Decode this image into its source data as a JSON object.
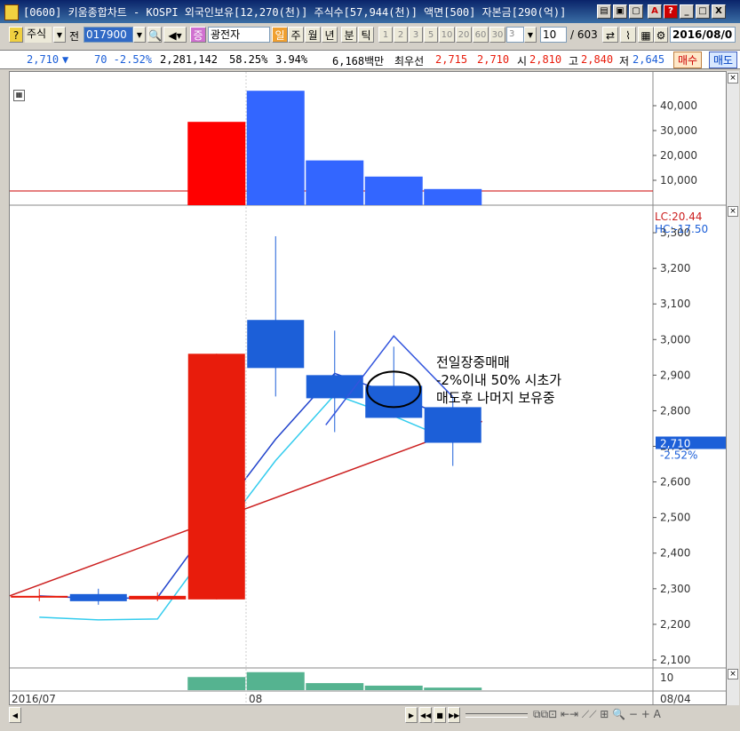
{
  "window": {
    "title": "[0600] 키움종합차트 - KOSPI 외국인보유[12,270(천)] 주식수[57,944(천)] 액면[500] 자본금[290(억)]",
    "buttons": [
      "A",
      "?",
      "_",
      "□",
      "X"
    ]
  },
  "toolbar": {
    "market_type": "주식",
    "prev_label": "전",
    "code": "017900",
    "badge": "증",
    "name": "광전자",
    "period_selected": "일",
    "periods": [
      "주",
      "월",
      "년",
      "분",
      "틱"
    ],
    "numbers": [
      "1",
      "2",
      "3",
      "5",
      "10",
      "20",
      "60",
      "30",
      "3"
    ],
    "count_value": "10",
    "count_total": "/ 603",
    "date": "2016/08/0"
  },
  "infobar": {
    "price": "2,710",
    "arrow": "▼",
    "change": "70 -2.52%",
    "volume": "2,281,142",
    "ratio1": "58.25%",
    "ratio2": "3.94%",
    "amount": "6,168백만",
    "best_label": "최우선",
    "best_ask": "2,715",
    "best_bid": "2,710",
    "open_label": "시",
    "open": "2,810",
    "high_label": "고",
    "high": "2,840",
    "low_label": "저",
    "low": "2,645",
    "sell_label": "매수",
    "buy_label": "매도"
  },
  "chart_data": {
    "type": "candlestick",
    "dates": [
      "07-d1",
      "07-d2",
      "07-d3",
      "08-01",
      "08-02",
      "08-03",
      "08-04"
    ],
    "candles": [
      {
        "open": 2275,
        "close": 2280,
        "high": 2300,
        "low": 2265
      },
      {
        "open": 2285,
        "close": 2265,
        "high": 2300,
        "low": 2255
      },
      {
        "open": 2270,
        "close": 2280,
        "high": 2290,
        "low": 2265
      },
      {
        "open": 2270,
        "close": 2960,
        "high": 2960,
        "low": 2270
      },
      {
        "open": 3055,
        "close": 2920,
        "high": 3290,
        "low": 2840
      },
      {
        "open": 2900,
        "close": 2835,
        "high": 3025,
        "low": 2740
      },
      {
        "open": 2870,
        "close": 2780,
        "high": 2980,
        "low": 2780
      },
      {
        "open": 2810,
        "close": 2710,
        "high": 2840,
        "low": 2645
      }
    ],
    "volumes": [
      0,
      0,
      0,
      33500,
      46000,
      18000,
      11500,
      6500
    ],
    "volume_axis": [
      "40,000",
      "30,000",
      "20,000",
      "10,000"
    ],
    "volume_ylim": [
      0,
      50000
    ],
    "price_ylim": [
      2080,
      3340
    ],
    "price_ticks": [
      "3,300",
      "3,200",
      "3,100",
      "3,000",
      "2,900",
      "2,800",
      "2,700",
      "2,600",
      "2,500",
      "2,400",
      "2,300",
      "2,200",
      "2,100"
    ],
    "lc_label": "LC:20.44",
    "hc_label": "HC:-17.50",
    "current_price_label": "2,710",
    "current_change_label": "-2.52%",
    "annotation_lines": [
      "전일장중매매",
      "-2%이내 50% 시초가",
      "매도후 나머지 보유중"
    ],
    "x_labels": [
      "2016/07",
      "08",
      "08/04"
    ],
    "sub_axis_label": "10",
    "colors": {
      "up": "#e81c0c",
      "down": "#1c5fd8",
      "volume_up": "#ff0000",
      "volume_down": "#3366ff",
      "sub_volume": "#55b390"
    }
  }
}
